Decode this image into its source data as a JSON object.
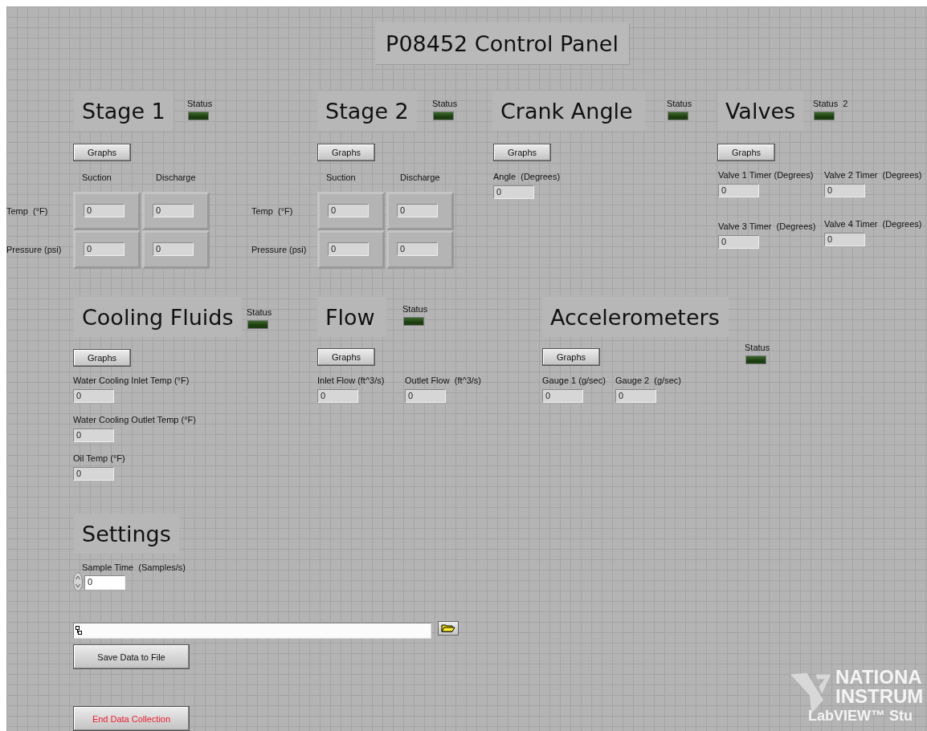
{
  "panel_title": "P08452 Control Panel",
  "sections": [
    {
      "kind": "table",
      "title": "Stage 1",
      "status": {
        "label": "Status",
        "on": false
      },
      "graphs_button": "Graphs",
      "columns": [
        "Suction",
        "Discharge"
      ],
      "rows": [
        {
          "label": "Temp  (°F)",
          "values": [
            "0",
            "0"
          ]
        },
        {
          "label": "Pressure (psi)",
          "values": [
            "0",
            "0"
          ]
        }
      ]
    },
    {
      "kind": "table",
      "title": "Stage 2",
      "status": {
        "label": "Status",
        "on": false
      },
      "graphs_button": "Graphs",
      "columns": [
        "Suction",
        "Discharge"
      ],
      "rows": [
        {
          "label": "Temp  (°F)",
          "values": [
            "0",
            "0"
          ]
        },
        {
          "label": "Pressure (psi)",
          "values": [
            "0",
            "0"
          ]
        }
      ]
    },
    {
      "kind": "fields",
      "title": "Crank Angle",
      "status": {
        "label": "Status",
        "on": false
      },
      "graphs_button": "Graphs",
      "fields": [
        {
          "label": "Angle  (Degrees)",
          "value": "0"
        }
      ]
    },
    {
      "kind": "fields",
      "title": "Valves",
      "status": {
        "label": "Status  2",
        "on": false
      },
      "graphs_button": "Graphs",
      "fields": [
        {
          "label": "Valve 1 Timer (Degrees)",
          "value": "0"
        },
        {
          "label": "Valve 2 Timer  (Degrees)",
          "value": "0"
        },
        {
          "label": "Valve 3 Timer  (Degrees)",
          "value": "0"
        },
        {
          "label": "Valve 4 Timer  (Degrees)",
          "value": "0"
        }
      ]
    },
    {
      "kind": "fields",
      "title": "Cooling Fluids",
      "status": {
        "label": "Status",
        "on": false
      },
      "graphs_button": "Graphs",
      "fields": [
        {
          "label": "Water Cooling Inlet Temp (°F)",
          "value": "0"
        },
        {
          "label": "Water Cooling Outlet Temp (°F)",
          "value": "0"
        },
        {
          "label": "Oil Temp (°F)",
          "value": "0"
        }
      ]
    },
    {
      "kind": "fields",
      "title": "Flow",
      "status": {
        "label": "Status",
        "on": false
      },
      "graphs_button": "Graphs",
      "fields": [
        {
          "label": "Inlet Flow (ft^3/s)",
          "value": "0"
        },
        {
          "label": "Outlet Flow  (ft^3/s)",
          "value": "0"
        }
      ]
    },
    {
      "kind": "fields",
      "title": "Accelerometers",
      "status": {
        "label": "Status",
        "on": false
      },
      "graphs_button": "Graphs",
      "fields": [
        {
          "label": "Gauge 1 (g/sec)",
          "value": "0"
        },
        {
          "label": "Gauge 2  (g/sec)",
          "value": "0"
        }
      ]
    }
  ],
  "settings": {
    "title": "Settings",
    "sample_time": {
      "label": "Sample Time  (Samples/s)",
      "value": "0"
    },
    "save_button": "Save Data to File",
    "end_button": "End Data Collection"
  },
  "logo": {
    "lines": [
      "NATIONA",
      "INSTRUM",
      "LabVIEW™ Stu"
    ]
  }
}
